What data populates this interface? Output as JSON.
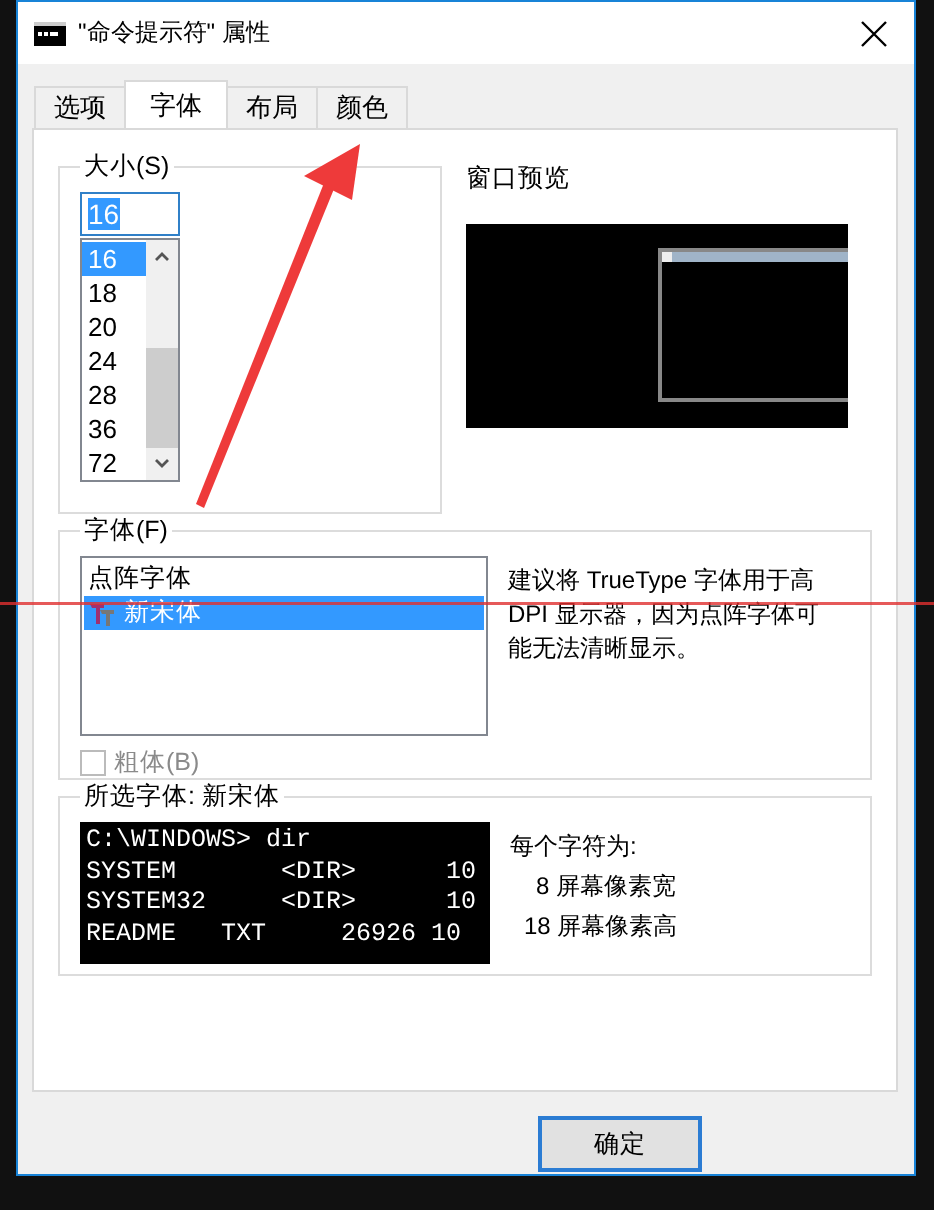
{
  "window": {
    "title": "\"命令提示符\" 属性"
  },
  "tabs": [
    {
      "label": "选项",
      "selected": false
    },
    {
      "label": "字体",
      "selected": true
    },
    {
      "label": "布局",
      "selected": false
    },
    {
      "label": "颜色",
      "selected": false
    }
  ],
  "size_group": {
    "label": "大小(S)",
    "value": "16",
    "items": [
      {
        "label": "16",
        "selected": true
      },
      {
        "label": "18",
        "selected": false
      },
      {
        "label": "20",
        "selected": false
      },
      {
        "label": "24",
        "selected": false
      },
      {
        "label": "28",
        "selected": false
      },
      {
        "label": "36",
        "selected": false
      },
      {
        "label": "72",
        "selected": false
      }
    ]
  },
  "preview": {
    "label": "窗口预览"
  },
  "font_group": {
    "label": "字体(F)",
    "items": [
      {
        "label": "点阵字体",
        "selected": false,
        "kind": "raster"
      },
      {
        "label": "新宋体",
        "selected": true,
        "kind": "truetype"
      }
    ],
    "note": "建议将 TrueType 字体用于高 DPI 显示器，因为点阵字体可能无法清晰显示。",
    "bold": {
      "label": "粗体(B)",
      "checked": false,
      "disabled": true
    }
  },
  "selected_font": {
    "label": "所选字体: 新宋体",
    "sample_lines": [
      "C:\\WINDOWS> dir",
      "SYSTEM       <DIR>      10",
      "SYSTEM32     <DIR>      10",
      "README   TXT     26926 10"
    ],
    "char_info": {
      "title": "每个字符为:",
      "width": "8 屏幕像素宽",
      "height": "18 屏幕像素高"
    }
  },
  "buttons": [
    {
      "label": "确定"
    }
  ]
}
